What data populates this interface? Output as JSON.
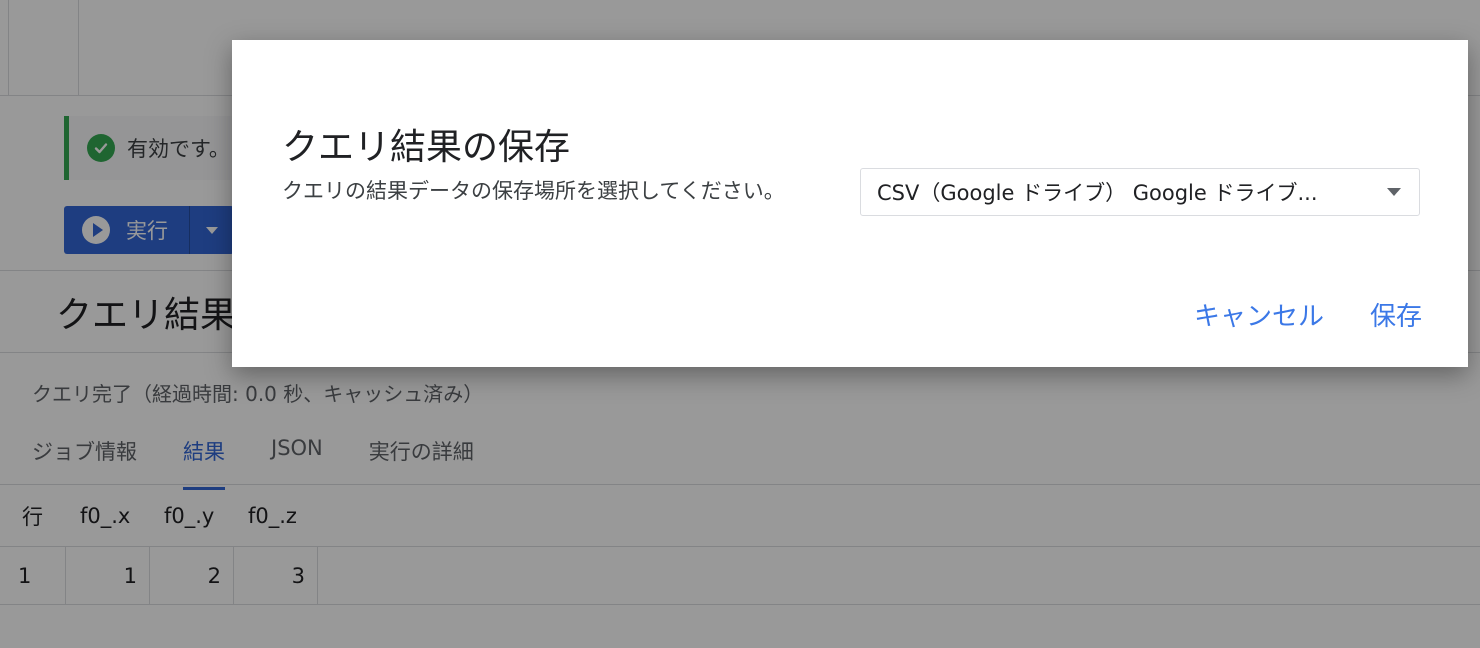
{
  "background": {
    "validation_text": "有効です。",
    "run_label": "実行",
    "results_title": "クエリ結果",
    "query_status": "クエリ完了（経過時間: 0.0 秒、キャッシュ済み）",
    "tabs": [
      {
        "label": "ジョブ情報",
        "active": false
      },
      {
        "label": "結果",
        "active": true
      },
      {
        "label": "JSON",
        "active": false
      },
      {
        "label": "実行の詳細",
        "active": false
      }
    ],
    "table": {
      "columns": [
        "行",
        "f0_.x",
        "f0_.y",
        "f0_.z"
      ],
      "rows": [
        [
          "1",
          "1",
          "2",
          "3"
        ]
      ]
    }
  },
  "dialog": {
    "title": "クエリ結果の保存",
    "prompt": "クエリの結果データの保存場所を選択してください。",
    "destination_value": "CSV（Google ドライブ） Google ドライブ...",
    "cancel_label": "キャンセル",
    "save_label": "保存"
  },
  "colors": {
    "accent": "#3367d6",
    "link": "#3b78e7",
    "success": "#34a853",
    "scrim": "rgba(0,0,0,0.40)"
  },
  "icons": [
    "check-circle-icon",
    "play-icon",
    "chevron-down-icon",
    "dropdown-caret-icon"
  ]
}
